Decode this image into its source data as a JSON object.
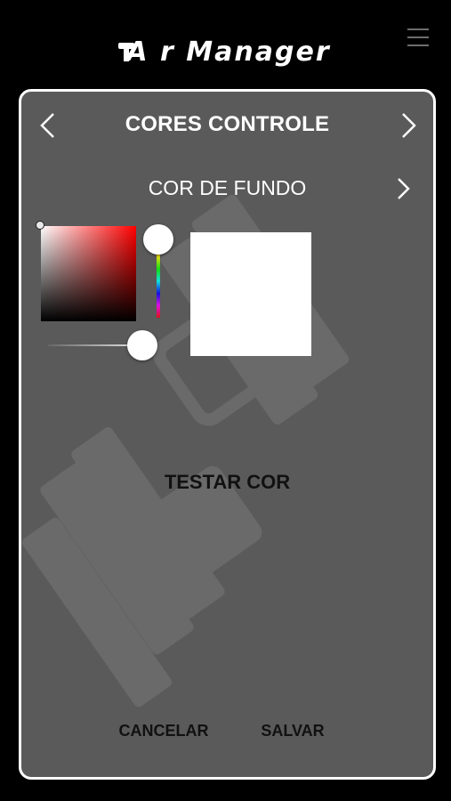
{
  "app": {
    "logo_text": "Air Manager"
  },
  "header": {
    "title": "CORES CONTROLE"
  },
  "section": {
    "subtitle": "COR DE FUNDO"
  },
  "color_picker": {
    "hue": "#ff0000",
    "selected_color": "#ffffff",
    "alpha_percent": 100
  },
  "actions": {
    "test_label": "TESTAR COR",
    "cancel_label": "CANCELAR",
    "save_label": "SALVAR"
  },
  "icons": {
    "menu": "hamburger-menu-icon",
    "prev": "chevron-left-icon",
    "next": "chevron-right-icon"
  }
}
